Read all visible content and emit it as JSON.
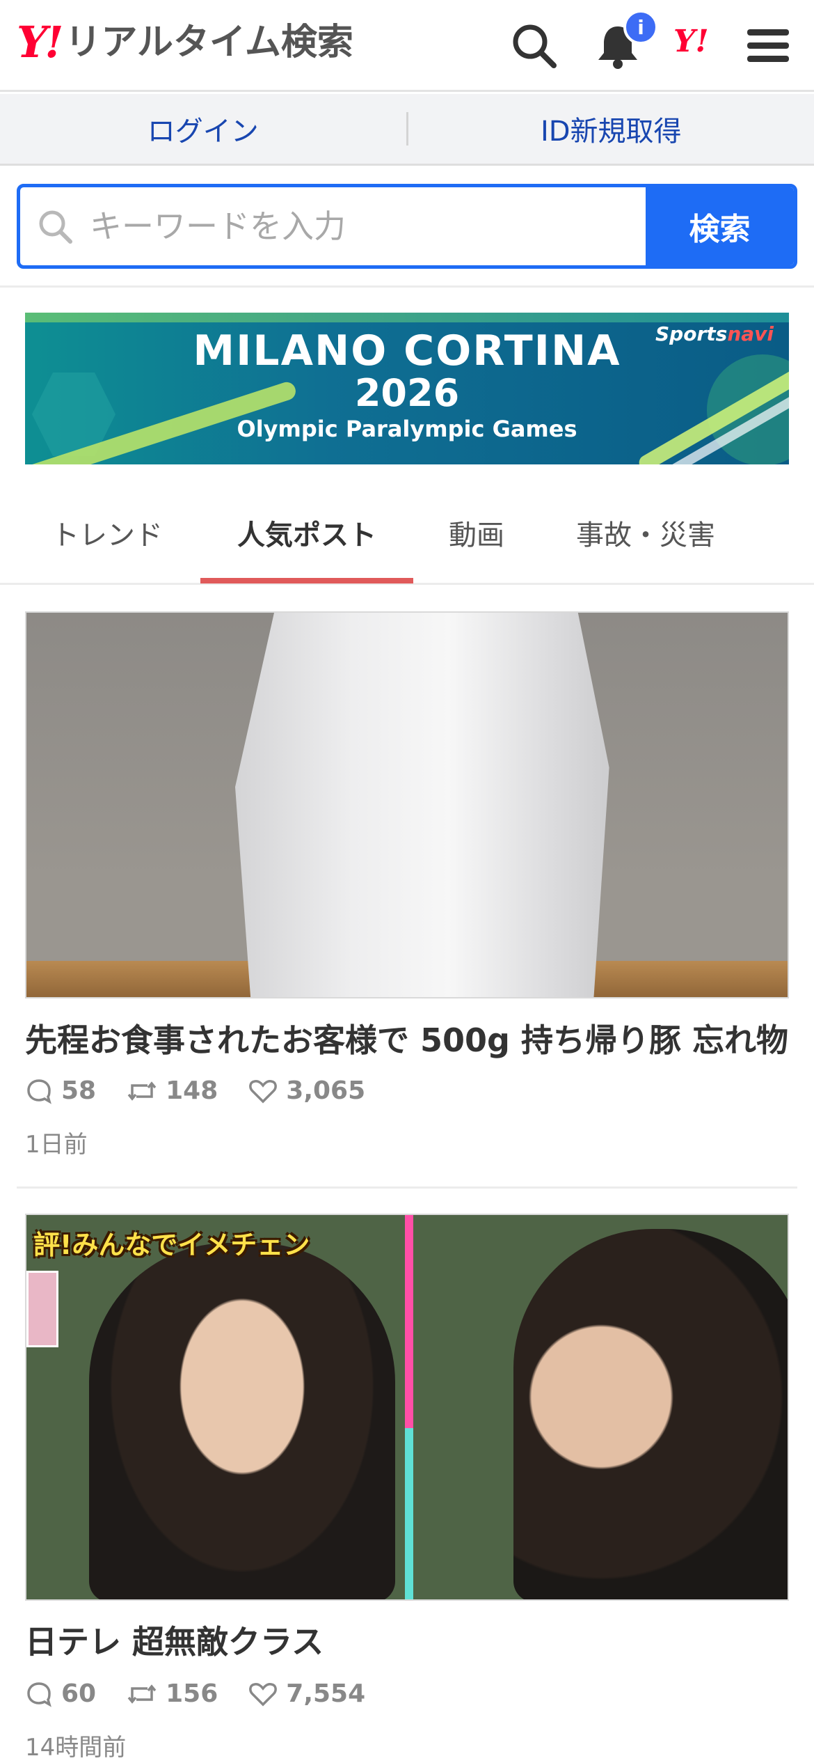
{
  "header": {
    "logo_mark": "Y!",
    "logo_text": "リアルタイム検索",
    "notification_badge": "i",
    "yj_mark": "Y!"
  },
  "account": {
    "login": "ログイン",
    "register": "ID新規取得"
  },
  "search": {
    "placeholder": "キーワードを入力",
    "button": "検索"
  },
  "banner": {
    "line1": "MILANO CORTINA",
    "line2": "2026",
    "line3": "Olympic Paralympic Games",
    "brand_part1": "Sports",
    "brand_part2": "navi"
  },
  "tabs": [
    {
      "label": "トレンド",
      "active": false
    },
    {
      "label": "人気ポスト",
      "active": true
    },
    {
      "label": "動画",
      "active": false
    },
    {
      "label": "事故・災害",
      "active": false
    }
  ],
  "posts": [
    {
      "title": "先程お食事されたお客様で 500g 持ち帰り豚 忘れ物",
      "replies": "58",
      "reposts": "148",
      "likes": "3,065",
      "time": "1日前"
    },
    {
      "title": "日テレ 超無敵クラス",
      "image_caption": "評!みんなでイメチェン",
      "replies": "60",
      "reposts": "156",
      "likes": "7,554",
      "time": "14時間前"
    }
  ],
  "colors": {
    "brand_red": "#ff0033",
    "search_blue": "#1e6cf5",
    "link_blue": "#1846b0",
    "tab_underline": "#e05a5a"
  }
}
